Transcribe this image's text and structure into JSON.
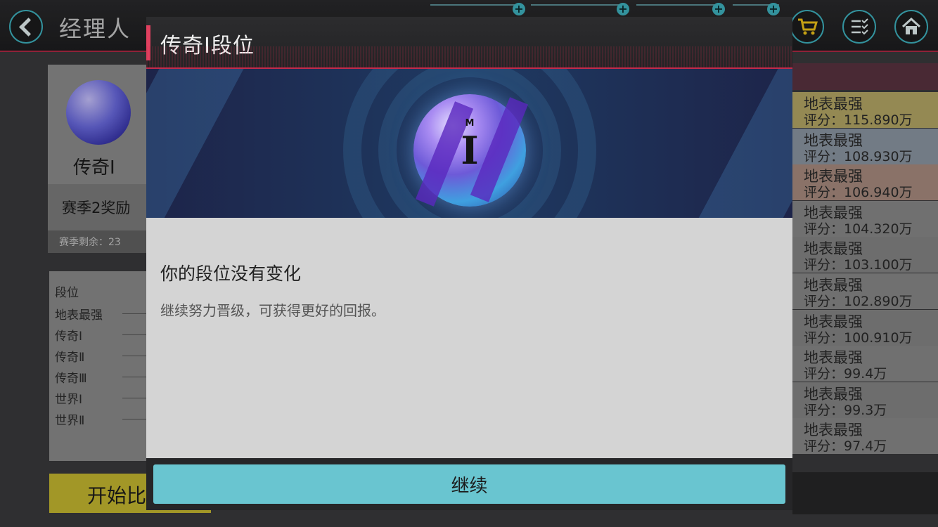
{
  "screen": {
    "title": "经理人"
  },
  "background": {
    "rank_card_name": "传奇Ⅰ",
    "reward_label": "赛季2奖励",
    "season_remaining": "赛季剩余：23",
    "tier_header": "段位",
    "tiers": [
      "地表最强",
      "传奇Ⅰ",
      "传奇Ⅱ",
      "传奇Ⅲ",
      "世界Ⅰ",
      "世界Ⅱ"
    ],
    "start_button": "开始比",
    "leaderboard": [
      {
        "name": "地表最强",
        "score": "评分：115.890万",
        "color": "#b5a866"
      },
      {
        "name": "地表最强",
        "score": "评分：108.930万",
        "color": "#8c96a3"
      },
      {
        "name": "地表最强",
        "score": "评分：106.940万",
        "color": "#a98c7f"
      },
      {
        "name": "地表最强",
        "score": "评分：104.320万",
        "color": "#898989"
      },
      {
        "name": "地表最强",
        "score": "评分：103.100万",
        "color": "#858585"
      },
      {
        "name": "地表最强",
        "score": "评分：102.890万",
        "color": "#898989"
      },
      {
        "name": "地表最强",
        "score": "评分：100.910万",
        "color": "#858585"
      },
      {
        "name": "地表最强",
        "score": "评分：99.4万",
        "color": "#898989"
      },
      {
        "name": "地表最强",
        "score": "评分：99.3万",
        "color": "#858585"
      },
      {
        "name": "地表最强",
        "score": "评分：97.4万",
        "color": "#898989"
      }
    ]
  },
  "dialog": {
    "title": "传奇Ⅰ段位",
    "badge_letter": "I",
    "badge_mark": "M",
    "message_title": "你的段位没有变化",
    "message_body": "继续努力晋级，可获得更好的回报。",
    "continue_label": "继续"
  },
  "colors": {
    "accent_red": "#c42a4a",
    "accent_cyan": "#69c5d0",
    "cart_yellow": "#f0c419"
  },
  "icons": [
    "back-icon",
    "plus-icon",
    "cart-icon",
    "list-check-icon",
    "home-icon",
    "stopwatch-icon",
    "rank-ball-icon"
  ]
}
